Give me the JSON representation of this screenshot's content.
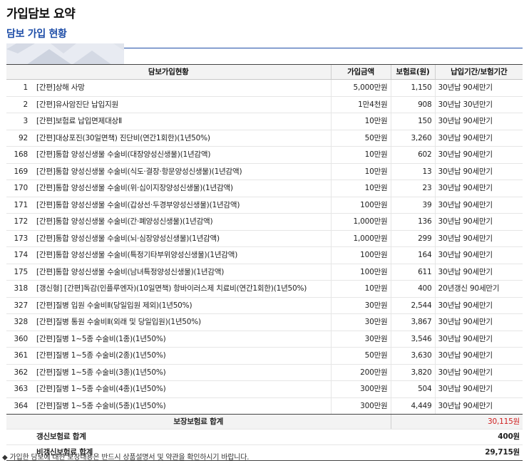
{
  "page_title": "가입담보 요약",
  "section_title": "담보 가입 현황",
  "table": {
    "headers": {
      "coverage": "담보가입현황",
      "amount": "가입금액",
      "premium": "보험료(원)",
      "term": "납입기간/보험기간"
    },
    "rows": [
      {
        "no": "1",
        "name": "[간편]상해 사망",
        "amount": "5,000만원",
        "premium": "1,150",
        "term": "30년납 90세만기"
      },
      {
        "no": "2",
        "name": "[간편]유사암진단 납입지원",
        "amount": "1만4천원",
        "premium": "908",
        "term": "30년납 30년만기"
      },
      {
        "no": "3",
        "name": "[간편]보험료 납입면제대상Ⅱ",
        "amount": "10만원",
        "premium": "150",
        "term": "30년납 90세만기"
      },
      {
        "no": "92",
        "name": "[간편]대상포진(30일면책) 진단비(연간1회한)(1년50%)",
        "amount": "50만원",
        "premium": "3,260",
        "term": "30년납 90세만기"
      },
      {
        "no": "168",
        "name": "[간편]통합 양성신생물 수술비(대장양성신생물)(1년감액)",
        "amount": "10만원",
        "premium": "602",
        "term": "30년납 90세만기"
      },
      {
        "no": "169",
        "name": "[간편]통합 양성신생물 수술비(식도·결장·항문양성신생물)(1년감액)",
        "amount": "10만원",
        "premium": "13",
        "term": "30년납 90세만기"
      },
      {
        "no": "170",
        "name": "[간편]통합 양성신생물 수술비(위·십이지장양성신생물)(1년감액)",
        "amount": "10만원",
        "premium": "23",
        "term": "30년납 90세만기"
      },
      {
        "no": "171",
        "name": "[간편]통합 양성신생물 수술비(갑상선·두경부양성신생물)(1년감액)",
        "amount": "100만원",
        "premium": "39",
        "term": "30년납 90세만기"
      },
      {
        "no": "172",
        "name": "[간편]통합 양성신생물 수술비(간·폐양성신생물)(1년감액)",
        "amount": "1,000만원",
        "premium": "136",
        "term": "30년납 90세만기"
      },
      {
        "no": "173",
        "name": "[간편]통합 양성신생물 수술비(뇌·심장양성신생물)(1년감액)",
        "amount": "1,000만원",
        "premium": "299",
        "term": "30년납 90세만기"
      },
      {
        "no": "174",
        "name": "[간편]통합 양성신생물 수술비(특정기타부위양성신생물)(1년감액)",
        "amount": "100만원",
        "premium": "164",
        "term": "30년납 90세만기"
      },
      {
        "no": "175",
        "name": "[간편]통합 양성신생물 수술비(남녀특정양성신생물)(1년감액)",
        "amount": "100만원",
        "premium": "611",
        "term": "30년납 90세만기"
      },
      {
        "no": "318",
        "name": "[갱신형] [간편]독감(인플루엔자)(10일면책) 항바이러스제 치료비(연간1회한)(1년50%)",
        "amount": "10만원",
        "premium": "400",
        "term": "20년갱신 90세만기"
      },
      {
        "no": "327",
        "name": "[간편]질병 입원 수술비Ⅱ(당일입원 제외)(1년50%)",
        "amount": "30만원",
        "premium": "2,544",
        "term": "30년납 90세만기"
      },
      {
        "no": "328",
        "name": "[간편]질병 통원 수술비Ⅱ(외래 및 당일입원)(1년50%)",
        "amount": "30만원",
        "premium": "3,867",
        "term": "30년납 90세만기"
      },
      {
        "no": "360",
        "name": "[간편]질병 1~5종 수술비(1종)(1년50%)",
        "amount": "30만원",
        "premium": "3,546",
        "term": "30년납 90세만기"
      },
      {
        "no": "361",
        "name": "[간편]질병 1~5종 수술비(2종)(1년50%)",
        "amount": "50만원",
        "premium": "3,630",
        "term": "30년납 90세만기"
      },
      {
        "no": "362",
        "name": "[간편]질병 1~5종 수술비(3종)(1년50%)",
        "amount": "200만원",
        "premium": "3,820",
        "term": "30년납 90세만기"
      },
      {
        "no": "363",
        "name": "[간편]질병 1~5종 수술비(4종)(1년50%)",
        "amount": "300만원",
        "premium": "504",
        "term": "30년납 90세만기"
      },
      {
        "no": "364",
        "name": "[간편]질병 1~5종 수술비(5종)(1년50%)",
        "amount": "300만원",
        "premium": "4,449",
        "term": "30년납 90세만기"
      }
    ]
  },
  "summary": {
    "total_label": "보장보험료 합계",
    "total_value": "30,115원",
    "renewal_label": "갱신보험료 합계",
    "renewal_value": "400원",
    "nonrenewal_label": "비갱신보험료 합계",
    "nonrenewal_value": "29,715원"
  },
  "footnote": "◆ 가입한 담보에 대한 보장내용은 반드시 상품설명서 및 약관을 확인하시기 바랍니다.",
  "colors": {
    "section_title": "#1f4ea8",
    "total_value": "#d02020",
    "header_bg": "#f3f3f3"
  }
}
